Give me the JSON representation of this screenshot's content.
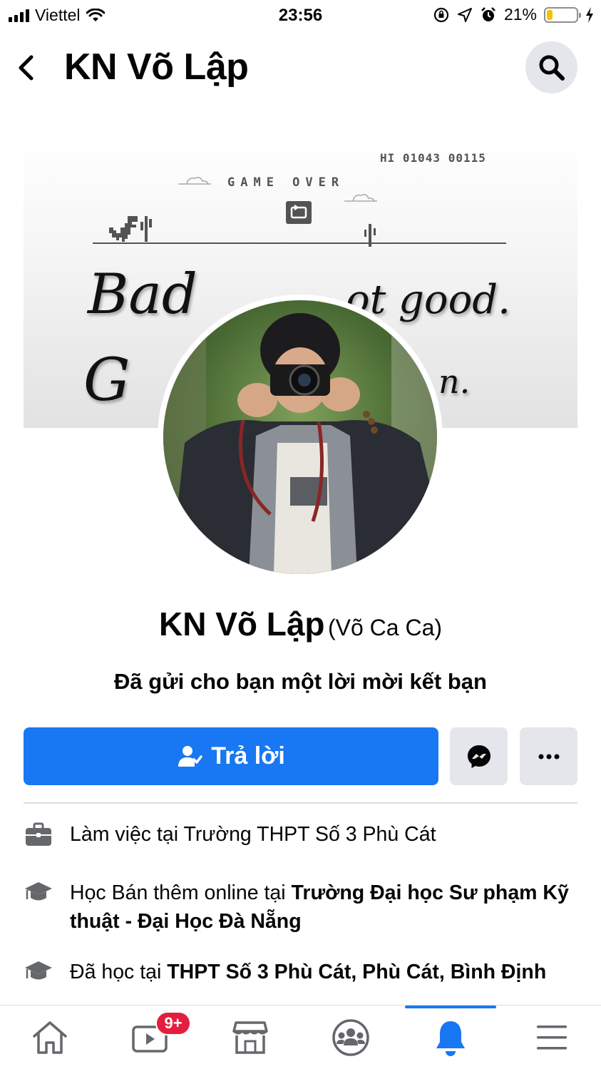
{
  "status_bar": {
    "carrier": "Viettel",
    "time": "23:56",
    "battery_percent": "21%",
    "battery_level": 0.21,
    "icons": [
      "signal-icon",
      "wifi-icon",
      "orientation-lock-icon",
      "location-icon",
      "alarm-icon",
      "battery-icon",
      "charging-icon"
    ]
  },
  "header": {
    "title": "KN Võ Lập",
    "back_icon": "chevron-left-icon",
    "search_icon": "search-icon"
  },
  "cover": {
    "hi_score": "HI 01043 00115",
    "game_over": "GAME OVER",
    "line1_left": "Bad",
    "line1_right": "ot good.",
    "line2_left": "G",
    "line2_right": "n."
  },
  "profile": {
    "name": "KN Võ Lập",
    "nickname": "(Võ Ca Ca)",
    "request_text": "Đã gửi cho bạn một lời mời kết bạn"
  },
  "actions": {
    "reply_label": "Trả lời",
    "reply_icon": "person-reply-icon",
    "messenger_icon": "messenger-icon",
    "more_icon": "more-icon"
  },
  "info": {
    "work": {
      "prefix": "Làm việc tại Trường THPT Số 3 Phù Cát",
      "icon": "briefcase-icon"
    },
    "study": {
      "prefix": "Học Bán thêm online tại ",
      "place": "Trường Đại học Sư phạm Kỹ thuật - Đại Học Đà Nẵng",
      "icon": "graduation-cap-icon"
    },
    "studied": {
      "prefix": "Đã học tại ",
      "place": "THPT Số 3 Phù Cát, Phù Cát, Bình Định",
      "icon": "graduation-cap-icon"
    }
  },
  "bottom_nav": {
    "items": [
      "home-icon",
      "watch-icon",
      "marketplace-icon",
      "groups-icon",
      "notifications-icon",
      "menu-icon"
    ],
    "active": "notifications-icon",
    "watch_badge": "9+"
  },
  "colors": {
    "accent": "#1877f2",
    "badge": "#e41e3f",
    "button_gray": "#e4e6eb",
    "icon_gray": "#65676b"
  }
}
